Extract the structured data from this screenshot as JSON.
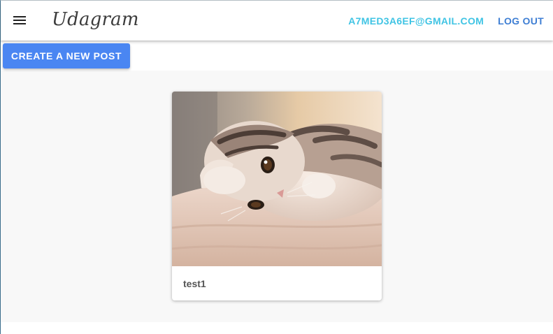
{
  "header": {
    "menu_icon": "hamburger-menu-icon",
    "brand": "Udagram",
    "user_email": "A7MED3A6EF@GMAIL.COM",
    "logout_label": "LOG OUT"
  },
  "actions": {
    "create_post_label": "CREATE A NEW POST"
  },
  "feed": {
    "posts": [
      {
        "caption": "test1",
        "image_subject": "kitten lying on a bed"
      }
    ]
  },
  "colors": {
    "accent_button": "#4a86f2",
    "email_link": "#40c4e4",
    "logout_link": "#3f7fd4",
    "content_background": "#f8f8f8"
  }
}
